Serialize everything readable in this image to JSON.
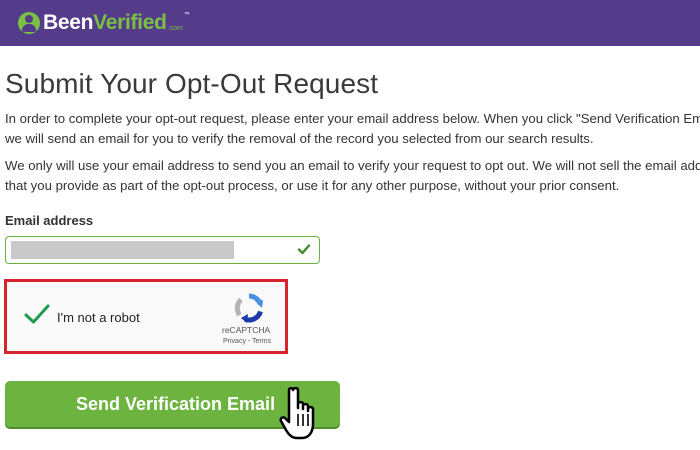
{
  "brand": {
    "part1": "Been",
    "part2": "Verified",
    "suffix": ".com",
    "tm": "™"
  },
  "page": {
    "title": "Submit Your Opt-Out Request",
    "paragraph1": [
      "In order to complete your opt-out request, please enter your email address below. When you click \"Send Verification Email\",",
      "we will send an email for you to verify the removal of the record you selected from our search results."
    ],
    "paragraph2": [
      "We only will use your email address to send you an email to verify your request to opt out. We will not sell the email address",
      "that you provide as part of the opt-out process, or use it for any other purpose, without your prior consent."
    ]
  },
  "form": {
    "email_label": "Email address",
    "email_value": "",
    "captcha": {
      "label": "I'm not a robot",
      "brand": "reCAPTCHA",
      "links": "Privacy - Terms"
    },
    "submit_label": "Send Verification Email"
  },
  "icons": {
    "logo": "person-circle-icon",
    "email_valid": "checkmark-icon",
    "captcha_checked": "checkmark-icon",
    "recaptcha": "recaptcha-logo-icon",
    "cursor": "hand-pointer-icon"
  },
  "colors": {
    "header": "#553c8b",
    "brand_green": "#7ac143",
    "button": "#6cb33f",
    "highlight": "#d6232e"
  }
}
